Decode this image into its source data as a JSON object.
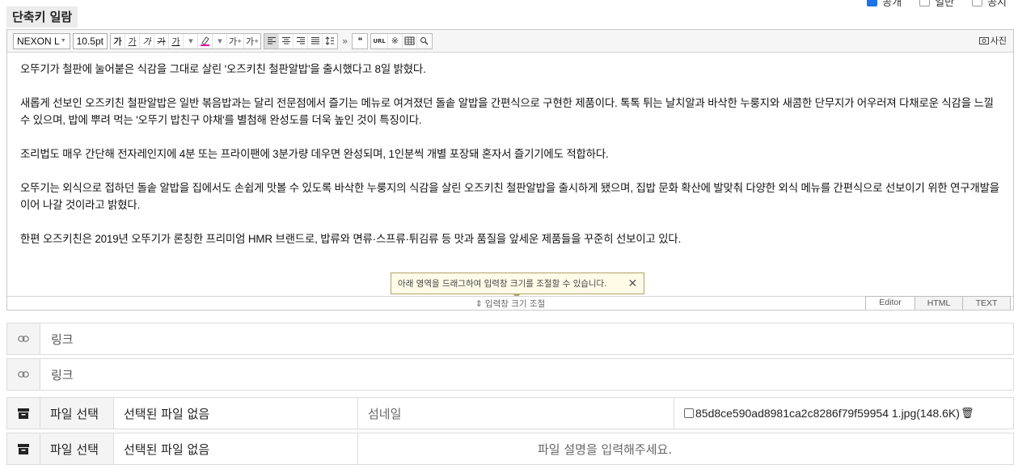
{
  "top_checks": [
    {
      "label": "공개",
      "checked": true
    },
    {
      "label": "일반",
      "checked": false
    },
    {
      "label": "공지",
      "checked": false
    }
  ],
  "shortcut_label": "단축키 일람",
  "toolbar": {
    "font_family": "NEXON L",
    "font_size": "10.5pt",
    "format_buttons": [
      "가",
      "가",
      "가",
      "가",
      "가"
    ],
    "superscript": "가",
    "subscript": "가",
    "url_label": "URL",
    "photo_label": "사진",
    "more": "»",
    "quote": "❝"
  },
  "content": {
    "paragraphs": [
      "오뚜기가 철판에 눌어붙은 식감을 그대로 살린 '오즈키친 철판알밥'을 출시했다고 8일 밝혔다.",
      "새롭게 선보인 오즈키친 철판알밥은 일반 볶음밥과는 달리 전문점에서 즐기는 메뉴로 여겨졌던 돌솥 알밥을 간편식으로 구현한 제품이다. 톡톡 튀는 날치알과 바삭한 누룽지와 새콤한 단무지가 어우러져 다채로운 식감을 느낄 수 있으며, 밥에 뿌려 먹는 '오뚜기 밥친구 야채'를 별첨해 완성도를 더욱 높인 것이 특징이다.",
      "조리법도 매우 간단해 전자레인지에 4분 또는 프라이팬에 3분가량 데우면 완성되며, 1인분씩 개별 포장돼 혼자서 즐기기에도 적합하다.",
      "오뚜기는 외식으로 접하던 돌솥 알밥을 집에서도 손쉽게 맛볼 수 있도록 바삭한 누룽지의 식감을 살린 오즈키친 철판알밥을 출시하게 됐으며, 집밥 문화 확산에 발맞춰 다양한 외식 메뉴를 간편식으로 선보이기 위한 연구개발을 이어 나갈 것이라고 밝혔다.",
      "한편 오즈키친은 2019년 오뚜기가 론칭한 프리미엄 HMR 브랜드로, 밥류와 면류·스프류·튀김류 등 맛과 품질을 앞세운 제품들을 꾸준히 선보이고 있다."
    ]
  },
  "tooltip": {
    "text": "아래 영역을 드래그하여 입력창 크기를 조절할 수 있습니다.",
    "close": "✕"
  },
  "resize_label": "⇕ 입력창 크기 조절",
  "mode_tabs": [
    "Editor",
    "HTML",
    "TEXT"
  ],
  "links": [
    {
      "placeholder": "링크"
    },
    {
      "placeholder": "링크"
    }
  ],
  "files": [
    {
      "button": "파일 선택",
      "status": "선택된 파일 없음",
      "description": "섬네일",
      "attachment": "85d8ce590ad8981ca2c8286f79f59954 1.jpg(148.6K)"
    },
    {
      "button": "파일 선택",
      "status": "선택된 파일 없음",
      "description": "파일 설명을 입력해주세요."
    }
  ]
}
